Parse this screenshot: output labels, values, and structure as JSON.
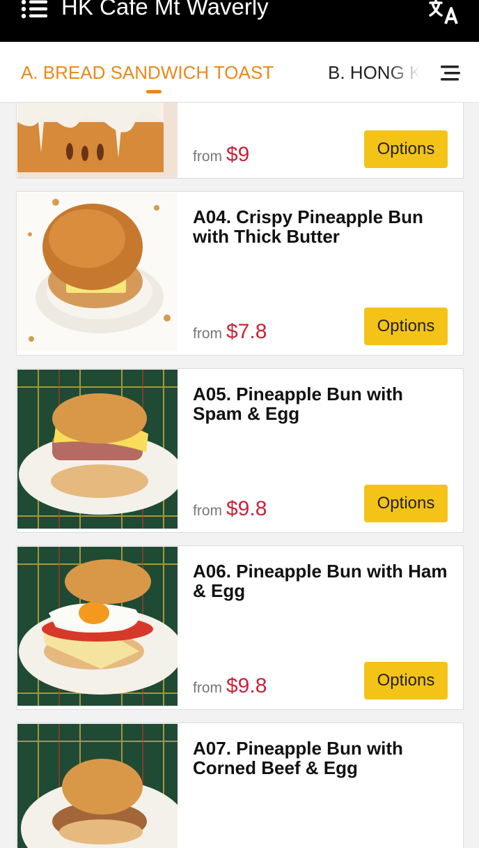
{
  "header": {
    "title": "HK Cafe Mt Waverly",
    "menu_icon": "menu-list-icon",
    "translate_icon": "translate-icon"
  },
  "tabs": [
    {
      "label": "A. BREAD SANDWICH TOAST",
      "active": true
    },
    {
      "label": "B. HONG KONG",
      "active": false
    }
  ],
  "colors": {
    "accent": "#e8891c",
    "price": "#c7243a",
    "button": "#f4c318",
    "header_bg": "#000000"
  },
  "items": [
    {
      "name": "",
      "from_label": "from",
      "price": "$9",
      "button": "Options"
    },
    {
      "name": "A04. Crispy Pineapple Bun with Thick Butter",
      "from_label": "from",
      "price": "$7.8",
      "button": "Options"
    },
    {
      "name": "A05. Pineapple Bun with Spam & Egg",
      "from_label": "from",
      "price": "$9.8",
      "button": "Options"
    },
    {
      "name": "A06. Pineapple Bun with Ham & Egg",
      "from_label": "from",
      "price": "$9.8",
      "button": "Options"
    },
    {
      "name": "A07. Pineapple Bun with Corned Beef & Egg",
      "from_label": "",
      "price": "",
      "button": ""
    }
  ]
}
